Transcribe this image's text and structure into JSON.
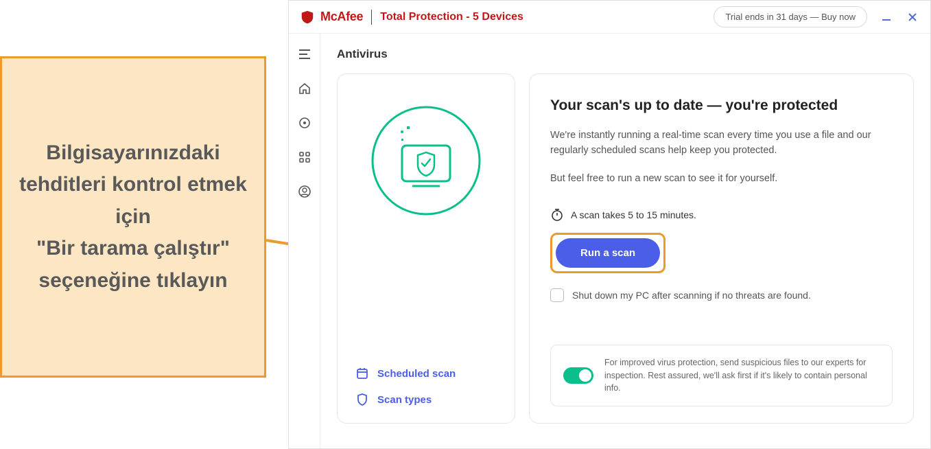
{
  "header": {
    "brand": "McAfee",
    "product": "Total Protection - 5 Devices",
    "trial": "Trial ends in 31 days — Buy now"
  },
  "page": {
    "title": "Antivirus"
  },
  "left_card": {
    "link_scheduled": "Scheduled scan",
    "link_types": "Scan types"
  },
  "right_card": {
    "heading": "Your scan's up to date — you're protected",
    "para1": "We're instantly running a real-time scan every time you use a file and our regularly scheduled scans help keep you protected.",
    "para2": "But feel free to run a new scan to see it for yourself.",
    "scan_time": "A scan takes 5 to 15 minutes.",
    "run_button": "Run a scan",
    "checkbox_label": "Shut down my PC after scanning if no threats are found.",
    "footer": "For improved virus protection, send suspicious files to our experts for inspection. Rest assured, we'll ask first if it's likely to contain personal info."
  },
  "callout": {
    "text": "Bilgisayarınızdaki tehditleri kontrol etmek için\n\"Bir tarama çalıştır\" seçeneğine tıklayın"
  }
}
